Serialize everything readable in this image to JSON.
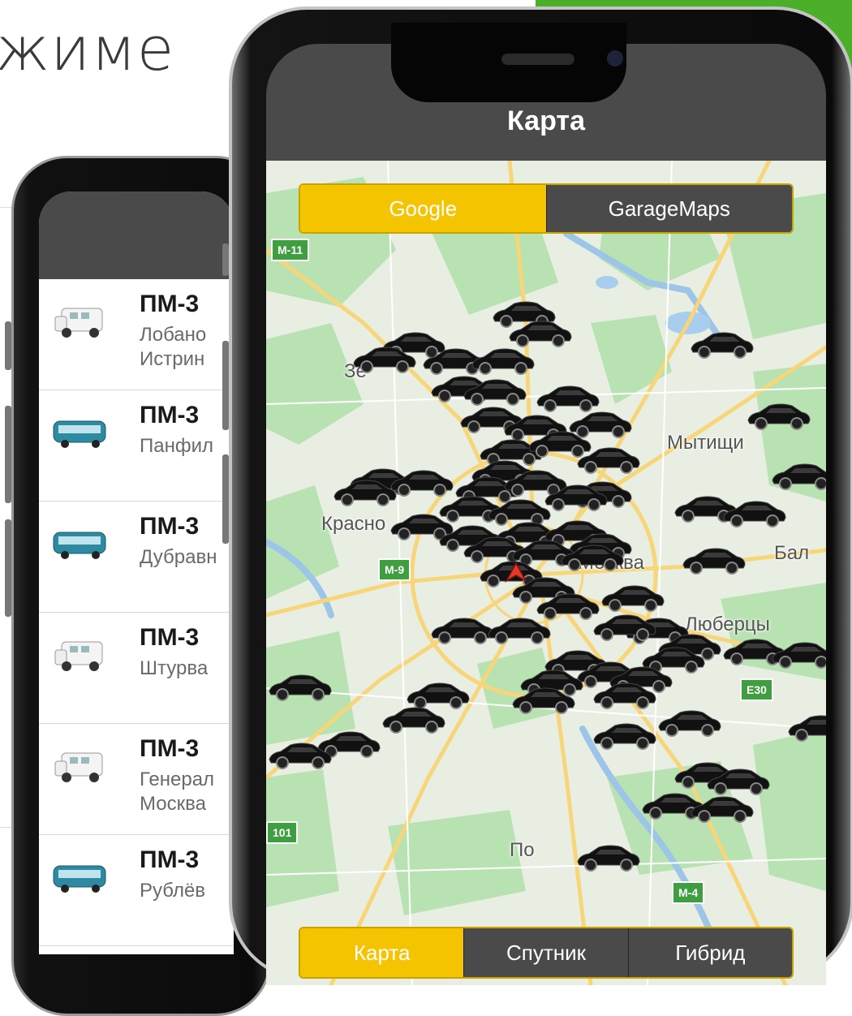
{
  "heading_fragment": "жиме",
  "colors": {
    "accent_yellow": "#f5c400",
    "header_gray": "#4a4a4a",
    "brand_green": "#4caf2a"
  },
  "back_phone": {
    "vehicles": [
      {
        "title": "ПМ-3",
        "lines": [
          "Лобано",
          "Истрин"
        ],
        "icon": "minibus-icon"
      },
      {
        "title": "ПМ-3",
        "lines": [
          "Панфил"
        ],
        "icon": "bus-icon"
      },
      {
        "title": "ПМ-3",
        "lines": [
          "Дубравн"
        ],
        "icon": "bus-icon"
      },
      {
        "title": "ПМ-3",
        "lines": [
          "Штурва"
        ],
        "icon": "minibus-icon"
      },
      {
        "title": "ПМ-3",
        "lines": [
          "Генерал",
          "Москва"
        ],
        "icon": "minibus-icon"
      },
      {
        "title": "ПМ-3",
        "lines": [
          "Рублёв"
        ],
        "icon": "bus-icon"
      }
    ]
  },
  "front_phone": {
    "title": "Карта",
    "provider_tabs": [
      {
        "label": "Google",
        "active": true
      },
      {
        "label": "GarageMaps",
        "active": false
      }
    ],
    "map_type_tabs": [
      {
        "label": "Карта",
        "active": true
      },
      {
        "label": "Спутник",
        "active": false
      },
      {
        "label": "Гибрид",
        "active": false
      }
    ],
    "map_labels": {
      "places": [
        "Зе",
        "Мытищи",
        "Красно",
        "Москва",
        "Бал",
        "Люберцы",
        "По",
        "ск"
      ],
      "roads": [
        "M-11",
        "M-9",
        "E30",
        "M-4",
        "101"
      ]
    }
  }
}
